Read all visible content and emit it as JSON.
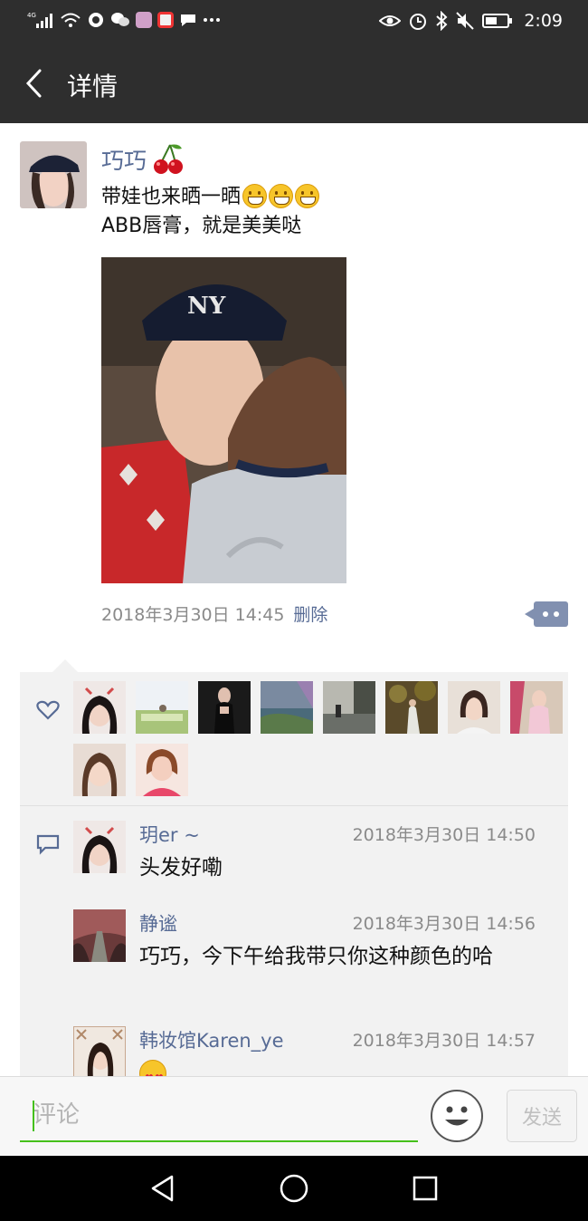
{
  "status_bar": {
    "signal_label": "4G",
    "time": "2:09"
  },
  "header": {
    "title": "详情"
  },
  "post": {
    "author": "巧巧",
    "text": "带娃也来晒一晒",
    "text_line2": "ABB唇膏，就是美美哒",
    "timestamp": "2018年3月30日 14:45",
    "delete_label": "删除"
  },
  "likes": {
    "count": 10
  },
  "comments": [
    {
      "author": "玥er ~",
      "time": "2018年3月30日 14:50",
      "text": "头发好嘞"
    },
    {
      "author": "静谧",
      "time": "2018年3月30日 14:56",
      "text": "巧巧，今下午给我带只你这种颜色的哈"
    },
    {
      "author": "韩妆馆Karen_ye",
      "time": "2018年3月30日 14:57",
      "text": ""
    }
  ],
  "input": {
    "placeholder": "评论",
    "send_label": "发送"
  },
  "colors": {
    "header_bg": "#2e2e2e",
    "link_blue": "#576b95",
    "panel_bg": "#f2f2f2",
    "input_accent": "#45c01a"
  }
}
